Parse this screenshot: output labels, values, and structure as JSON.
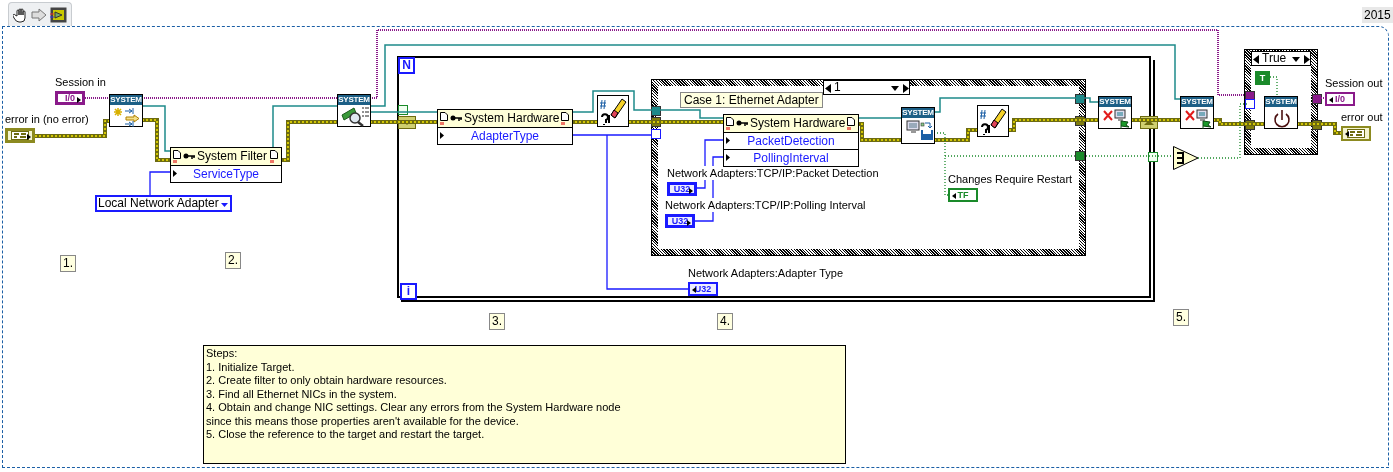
{
  "toolbar": {
    "version": "2015"
  },
  "terminals": [
    {
      "kind": "refnum",
      "indicator": false,
      "label": "Session in",
      "glyph": "I/0"
    },
    {
      "kind": "error",
      "indicator": false,
      "label": "error in (no error)"
    },
    {
      "kind": "u32",
      "indicator": false,
      "label": "Network Adapters:TCP/IP:Packet Detection",
      "glyph": "U32"
    },
    {
      "kind": "u32",
      "indicator": false,
      "label": "Network Adapters:TCP/IP:Polling Interval",
      "glyph": "U32"
    },
    {
      "kind": "bool",
      "indicator": true,
      "label": "Changes Require Restart",
      "glyph": "TF"
    },
    {
      "kind": "u32",
      "indicator": true,
      "label": "Network Adapters:Adapter Type",
      "glyph": "U32"
    },
    {
      "kind": "refnum",
      "indicator": true,
      "label": "Session out",
      "glyph": "I/0"
    },
    {
      "kind": "error",
      "indicator": true,
      "label": "error out"
    }
  ],
  "constants": [
    {
      "kind": "enum",
      "value": "Local Network Adapter"
    },
    {
      "kind": "bool",
      "value": "T"
    }
  ],
  "system_nodes": [
    {
      "kind": "open",
      "banner": "SYSTEM"
    },
    {
      "kind": "find",
      "banner": "SYSTEM"
    },
    {
      "kind": "save",
      "banner": "SYSTEM"
    },
    {
      "kind": "close",
      "banner": "SYSTEM"
    },
    {
      "kind": "close",
      "banner": "SYSTEM"
    },
    {
      "kind": "restart",
      "banner": "SYSTEM"
    }
  ],
  "property_nodes": [
    {
      "class": "System Filter",
      "properties": [
        "ServiceType"
      ]
    },
    {
      "class": "System Hardware",
      "properties": [
        "AdapterType"
      ]
    },
    {
      "class": "System Hardware",
      "properties": [
        "PacketDetection",
        "PollingInterval"
      ]
    }
  ],
  "clear_errors": [
    {
      "kind": "clear-errors"
    },
    {
      "kind": "clear-errors"
    }
  ],
  "for_loop": {
    "count_label": "N",
    "index_label": "i"
  },
  "case_structures": [
    {
      "selector": "1",
      "subdiagram_label": "Case 1: Ethernet Adapter"
    },
    {
      "selector": "True"
    }
  ],
  "step_labels": [
    "1.",
    "2.",
    "3.",
    "4.",
    "5."
  ],
  "comment": {
    "lines": [
      "Steps:",
      "1. Initialize Target.",
      "2. Create filter to only obtain hardware resources.",
      "3. Find all  Ethernet NICs in the system.",
      "4. Obtain and change NIC settings. Clear any errors from the System Hardware node",
      "since this means those properties aren't available for the device.",
      "5. Close the reference to the target and restart the target."
    ]
  }
}
